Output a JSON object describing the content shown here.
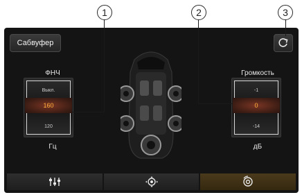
{
  "callouts": [
    "1",
    "2",
    "3"
  ],
  "header": {
    "subwoofer_label": "Сабвуфер"
  },
  "lpf": {
    "title": "ФНЧ",
    "above": "Выкл.",
    "selected": "160",
    "below": "120",
    "unit": "Гц"
  },
  "volume": {
    "title": "Громкость",
    "above": "-1",
    "selected": "0",
    "below": "-14",
    "unit": "дБ"
  },
  "icons": {
    "reset": "refresh-icon",
    "tab1": "equalizer-icon",
    "tab2": "sound-position-icon",
    "tab3": "subwoofer-icon"
  },
  "colors": {
    "selected_value": "#ffb23a",
    "active_tab": "#3f3116"
  }
}
